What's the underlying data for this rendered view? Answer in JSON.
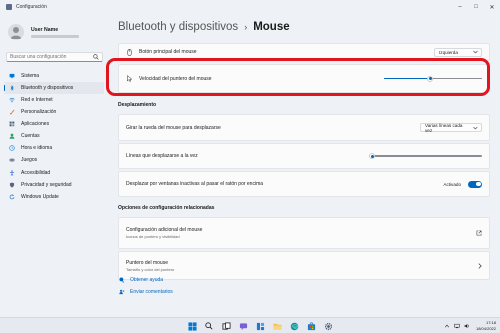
{
  "window": {
    "title": "Configuración"
  },
  "profile": {
    "user_name": "User Name"
  },
  "search": {
    "placeholder": "Buscar una configuración"
  },
  "sidebar": {
    "items": [
      {
        "label": "Sistema",
        "icon": "monitor-icon",
        "color": "#0078d4"
      },
      {
        "label": "Bluetooth y dispositivos",
        "icon": "bluetooth-icon",
        "color": "#0067c0"
      },
      {
        "label": "Red e Internet",
        "icon": "wifi-icon",
        "color": "#0078d4"
      },
      {
        "label": "Personalización",
        "icon": "brush-icon",
        "color": "#c0662d"
      },
      {
        "label": "Aplicaciones",
        "icon": "apps-icon",
        "color": "#4a5a75"
      },
      {
        "label": "Cuentas",
        "icon": "person-icon",
        "color": "#2aa06b"
      },
      {
        "label": "Hora e idioma",
        "icon": "globe-clock-icon",
        "color": "#1f8ad6"
      },
      {
        "label": "Juegos",
        "icon": "gamepad-icon",
        "color": "#6f7785"
      },
      {
        "label": "Accesibilidad",
        "icon": "accessibility-icon",
        "color": "#2a6fd6"
      },
      {
        "label": "Privacidad y seguridad",
        "icon": "shield-icon",
        "color": "#5a6680"
      },
      {
        "label": "Windows Update",
        "icon": "update-icon",
        "color": "#1f78d1"
      }
    ]
  },
  "breadcrumb": {
    "parent": "Bluetooth y dispositivos",
    "separator": "›",
    "current": "Mouse"
  },
  "settings": {
    "primary_button": {
      "label": "Botón principal del mouse",
      "value": "Izquierda"
    },
    "pointer_speed": {
      "label": "Velocidad del puntero del mouse",
      "level": 0.47
    },
    "scroll_section": "Desplazamiento",
    "scroll_wheel": {
      "label": "Girar la rueda del mouse para desplazarse",
      "value": "Varias líneas cada vez"
    },
    "scroll_lines": {
      "label": "Líneas que desplazarse a la vez",
      "level": 0.02
    },
    "inactive_scroll": {
      "label": "Desplazar por ventanas inactivas al pasar el ratón por encima",
      "state": "Activado"
    }
  },
  "related": {
    "title": "Opciones de configuración relacionadas",
    "items": [
      {
        "label": "Configuración adicional del mouse",
        "sub": "Iconos de puntero y visibilidad"
      },
      {
        "label": "Puntero del mouse",
        "sub": "Tamaño y color del puntero"
      }
    ]
  },
  "help": {
    "get_help": "Obtener ayuda",
    "feedback": "Enviar comentarios"
  },
  "taskbar": {
    "time": "17:18",
    "date": "18/04/2022"
  }
}
